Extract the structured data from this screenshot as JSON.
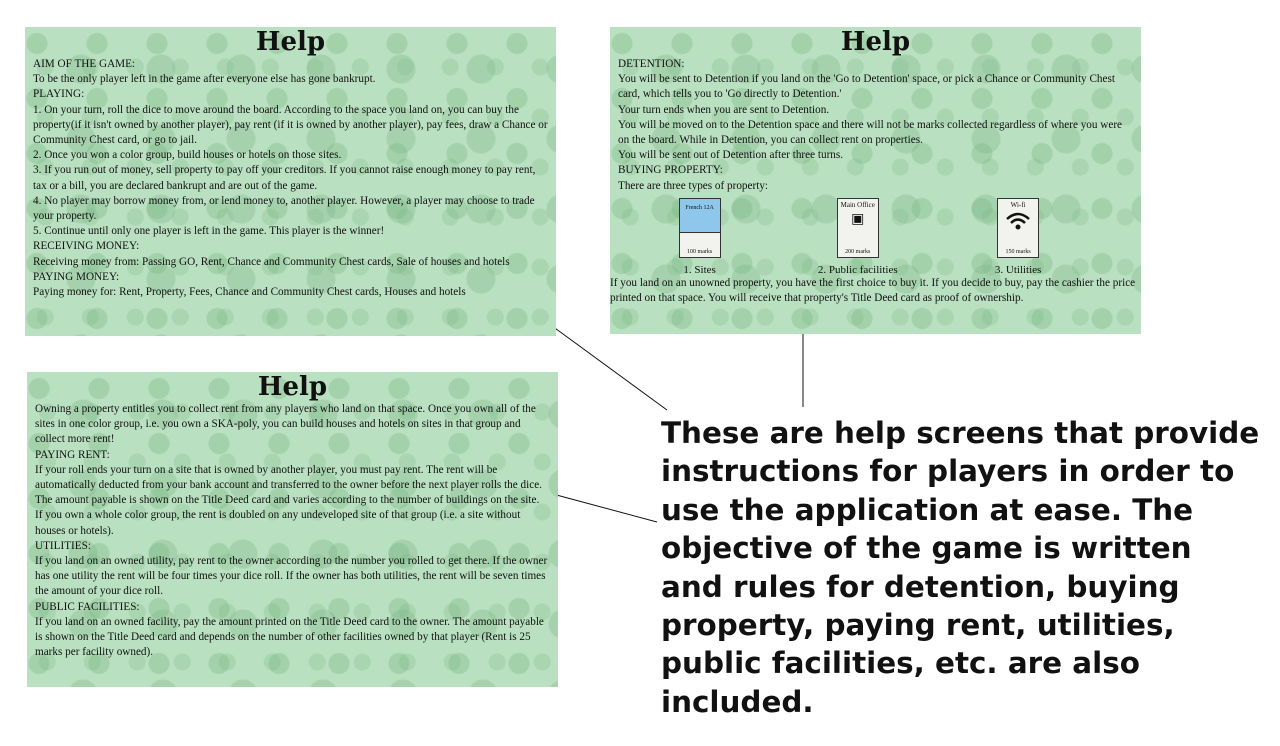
{
  "panel1": {
    "title": "Help",
    "lines": [
      "AIM OF THE GAME:",
      "To be the only player left in the game after everyone else has gone bankrupt.",
      "PLAYING:",
      "1. On your turn, roll the dice to move around the board. According to the space you land on, you can buy the property(if it isn't owned by another player), pay rent (if it is owned by another player), pay fees, draw a Chance or Community Chest card, or go to jail.",
      "2. Once you won a color group, build houses or hotels on those sites.",
      "3. If you run out of money, sell property to pay off your creditors. If you cannot raise enough money to pay rent, tax or a bill, you are declared bankrupt and are out of the game.",
      "4. No player may borrow money from, or lend money to, another player. However, a player may choose to trade your property.",
      "5. Continue until only one player is left in the game. This player is the winner!",
      "RECEIVING MONEY:",
      "Receiving money from: Passing GO, Rent, Chance and Community Chest cards, Sale of houses and hotels",
      "PAYING MONEY:",
      "Paying money for: Rent, Property, Fees, Chance and Community Chest cards, Houses and hotels"
    ]
  },
  "panel2": {
    "title": "Help",
    "lines": [
      "DETENTION:",
      "You will be sent to Detention if you land on the 'Go to Detention' space, or pick a Chance or Community Chest card, which tells you to 'Go directly to Detention.'",
      "Your turn ends when you are sent to Detention.",
      "You will be moved on to the Detention space and there will not be marks collected regardless of where you were on the board. While in Detention, you can collect rent on properties.",
      "You will be sent out of Detention after three turns.",
      "BUYING PROPERTY:",
      "There are three types of property:"
    ],
    "properties": [
      {
        "card_top": "French 12A",
        "card_bottom": "100 marks",
        "caption": "1. Sites"
      },
      {
        "card_top": "Main Office",
        "card_bottom": "200 marks",
        "caption": "2. Public facilities"
      },
      {
        "card_top": "Wi-fi",
        "card_bottom": "150 marks",
        "caption": "3. Utilities"
      }
    ],
    "after": "If you land on an unowned property, you have the first choice to buy it. If you decide to buy, pay the cashier the price printed on that space. You will receive that property's Title Deed card as proof of ownership."
  },
  "panel3": {
    "title": "Help",
    "lines": [
      "Owning a property entitles you to collect rent from any players who land on that space. Once you own all of the sites in one color group, i.e. you own a SKA-poly, you can build houses and hotels on sites in that group and collect more rent!",
      "PAYING RENT:",
      "If your roll ends your turn on a site that is owned by another player, you must pay rent. The rent will be automatically deducted from your bank account and transferred to the owner before the next player rolls the dice. The amount payable is shown on the Title Deed card and varies according to the number of buildings on the site.",
      "If you own a whole color group, the rent is doubled on any undeveloped site of that group (i.e. a site without houses or hotels).",
      "UTILITIES:",
      "If you land on an owned utility, pay rent to the owner according to the number you rolled to get there. If the owner has one utility the rent will be four times your dice roll. If the owner has both utilities, the rent will be seven times the amount of your dice roll.",
      "PUBLIC FACILITIES:",
      "If you land on an owned facility, pay the amount printed on the Title Deed card to the owner. The amount payable is shown on the Title Deed card and depends on the number of other facilities owned by that player (Rent is 25 marks per facility owned)."
    ]
  },
  "caption": "These are help screens that provide instructions for players in order to use the application at ease. The objective of the game is written and rules for detention, buying property, paying rent, utilities, public facilities, etc. are also included."
}
